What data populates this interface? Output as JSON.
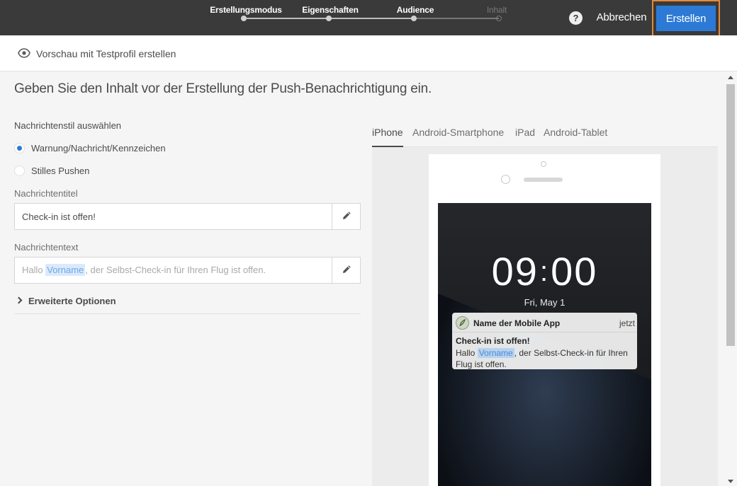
{
  "wizard": {
    "steps": [
      {
        "label": "Erstellungsmodus",
        "state": "done"
      },
      {
        "label": "Eigenschaften",
        "state": "done"
      },
      {
        "label": "Audience",
        "state": "done"
      },
      {
        "label": "Inhalt",
        "state": "pending"
      }
    ],
    "help_label": "?",
    "cancel_label": "Abbrechen",
    "create_label": "Erstellen"
  },
  "subheader": {
    "preview_label": "Vorschau mit Testprofil erstellen",
    "icon": "eye-icon"
  },
  "page": {
    "title": "Geben Sie den Inhalt vor der Erstellung der Push-Benachrichtigung ein."
  },
  "form": {
    "style_label": "Nachrichtenstil auswählen",
    "style_options": [
      {
        "label": "Warnung/Nachricht/Kennzeichen",
        "checked": true
      },
      {
        "label": "Stilles Pushen",
        "checked": false
      }
    ],
    "title_label": "Nachrichtentitel",
    "title_value": "Check-in ist offen!",
    "text_label": "Nachrichtentext",
    "text_prefix": "Hallo ",
    "text_token": "Vorname",
    "text_suffix": ", der Selbst-Check-in für Ihren Flug ist offen.",
    "advanced_label": "Erweiterte Optionen"
  },
  "preview": {
    "tabs": [
      {
        "label": "iPhone",
        "active": true
      },
      {
        "label": "Android-Smartphone",
        "active": false
      },
      {
        "label": "iPad",
        "active": false
      },
      {
        "label": "Android-Tablet",
        "active": false
      }
    ],
    "clock_hours": "09",
    "clock_minutes": "00",
    "date": "Fri, May 1",
    "notification": {
      "app_name": "Name der Mobile App",
      "time": "jetzt",
      "title": "Check-in ist offen!",
      "body_prefix": "Hallo ",
      "body_token": "Vorname",
      "body_suffix": ", der Selbst-Check-in für Ihren Flug ist offen."
    }
  },
  "colors": {
    "topbar": "#3a3a3a",
    "primary": "#2c7ad6",
    "highlight_border": "#e6893a",
    "token_bg": "#daeafc"
  }
}
